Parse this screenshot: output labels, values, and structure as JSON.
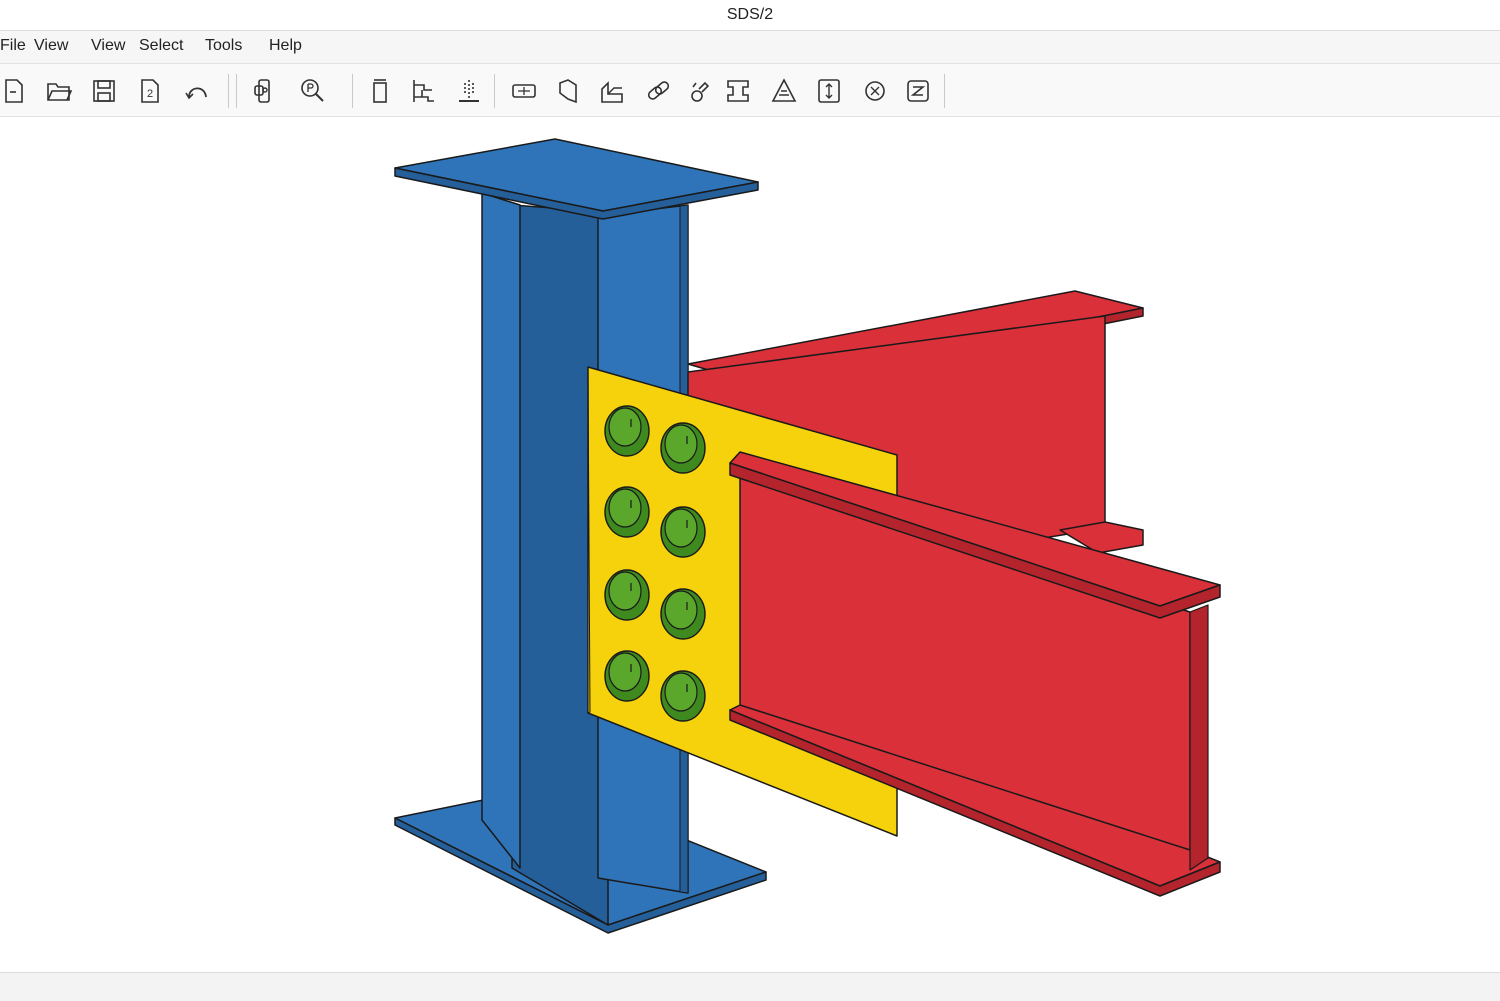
{
  "window": {
    "title": "SDS/2"
  },
  "menu": [
    {
      "label": "File"
    },
    {
      "label": "View"
    },
    {
      "label": "View"
    },
    {
      "label": "Select"
    },
    {
      "label": "Tools"
    },
    {
      "label": "Help"
    }
  ],
  "toolbar": {
    "tools": [
      {
        "icon": "new-file-icon"
      },
      {
        "icon": "open-folder-icon"
      },
      {
        "icon": "save-icon"
      },
      {
        "icon": "page-2-icon",
        "text": "2"
      },
      {
        "icon": "undo-icon"
      },
      {
        "icon": "member-edit-icon"
      },
      {
        "icon": "zoom-search-icon"
      },
      {
        "icon": "column-icon"
      },
      {
        "icon": "beam-connection-icon"
      },
      {
        "icon": "elevation-icon"
      },
      {
        "icon": "plate-icon"
      },
      {
        "icon": "bent-plate-icon"
      },
      {
        "icon": "angle-icon"
      },
      {
        "icon": "bolt-link-icon"
      },
      {
        "icon": "weld-icon"
      },
      {
        "icon": "shape-icon"
      },
      {
        "icon": "warning-triangle-icon"
      },
      {
        "icon": "dimension-icon"
      },
      {
        "icon": "snap-icon"
      },
      {
        "icon": "report-icon"
      }
    ]
  },
  "model": {
    "colors": {
      "column": "#2f74b8",
      "column_dark": "#255f99",
      "beam": "#d9303a",
      "beam_dark": "#b3242d",
      "plate": "#f5d20c",
      "bolt": "#5aa72c",
      "outline": "#1a1a1a"
    },
    "bolt_rows": 4,
    "bolt_cols": 2
  }
}
